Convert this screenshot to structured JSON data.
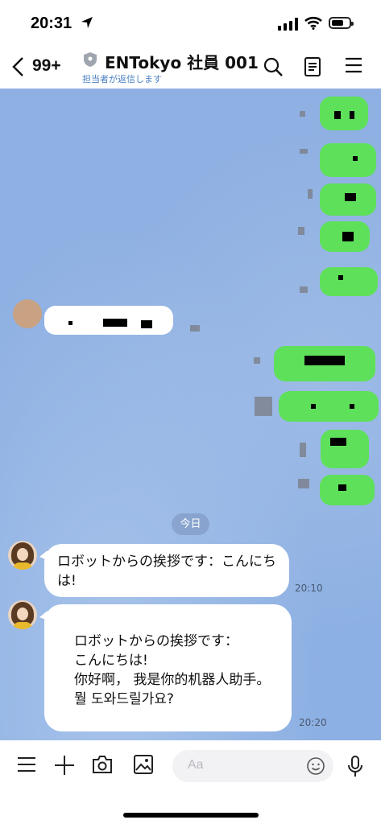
{
  "status": {
    "time": "20:31"
  },
  "header": {
    "back_count": "99+",
    "title": "ENTokyo 社員 001",
    "subtitle": "担当者が返信します"
  },
  "chat": {
    "date_label": "今日",
    "messages": [
      {
        "sender": "bot",
        "text": "ロボットからの挨拶です：こんにちは!",
        "time": "20:10"
      },
      {
        "sender": "bot",
        "text": "ロボットからの挨拶です：\nこんにちは!\n你好啊， 我是你的机器人助手。\n뭘 도와드릴가요?",
        "time": "20:20"
      }
    ]
  },
  "toolbar": {
    "input_placeholder": "Aa"
  },
  "colors": {
    "accent_green": "#5ee05a",
    "chat_bg": "#8fb0e2",
    "link_blue": "#4a7fc1"
  },
  "icons": [
    "location-arrow-icon",
    "cellular-icon",
    "wifi-icon",
    "battery-icon",
    "back-chevron-icon",
    "shield-icon",
    "search-icon",
    "notes-icon",
    "menu-icon",
    "list-icon",
    "plus-icon",
    "camera-icon",
    "image-icon",
    "emoji-icon",
    "mic-icon"
  ]
}
